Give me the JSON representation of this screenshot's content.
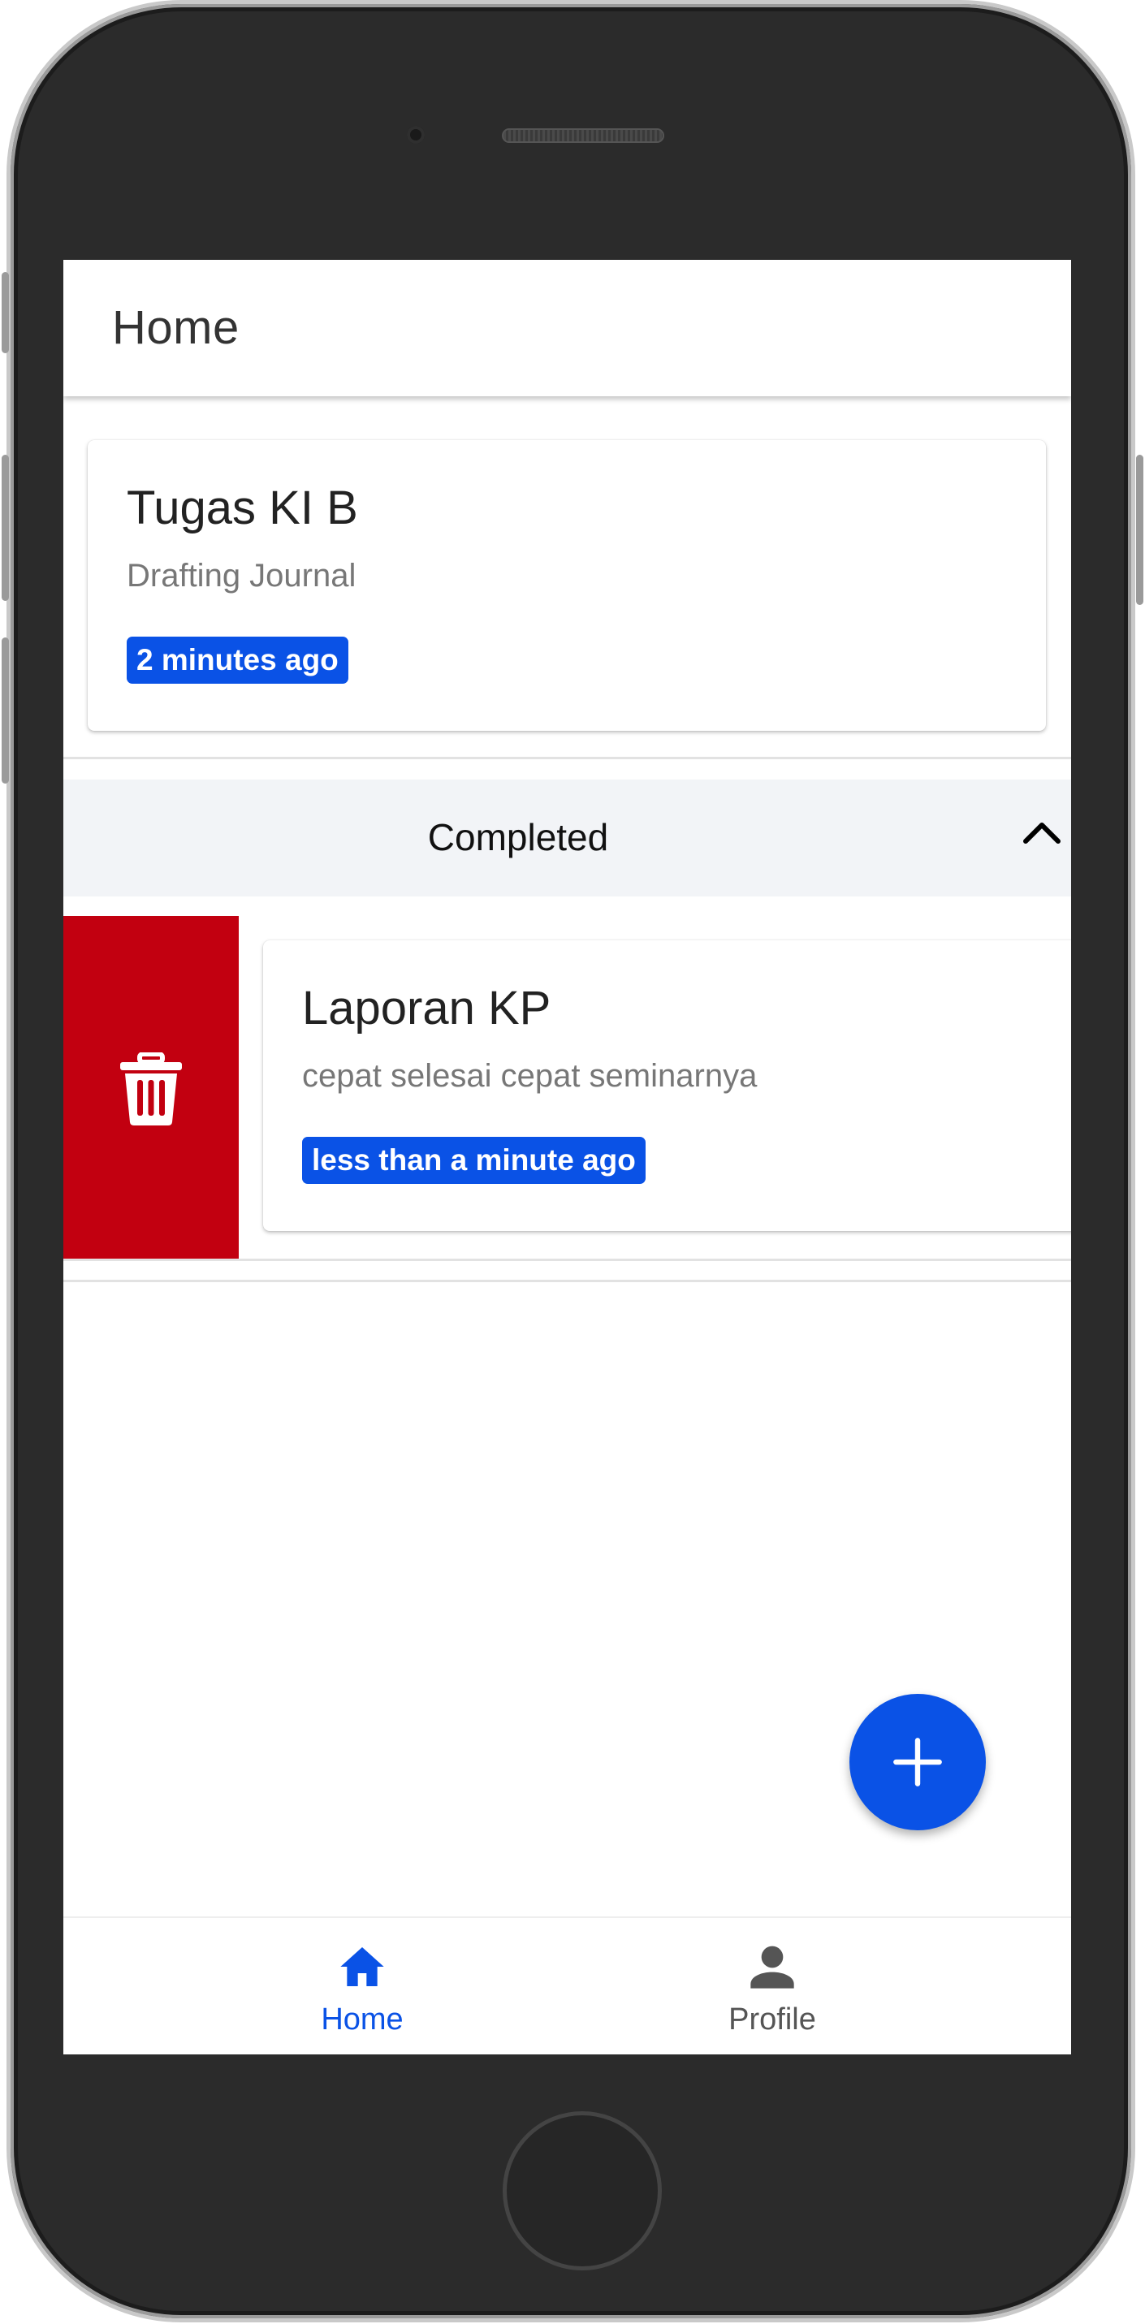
{
  "app": {
    "title": "Home"
  },
  "active_task": {
    "title": "Tugas KI B",
    "description": "Drafting Journal",
    "time": "2 minutes ago"
  },
  "completed_section": {
    "header": "Completed",
    "expanded": true,
    "items": [
      {
        "title": "Laporan KP",
        "description": "cepat selesai cepat seminarnya",
        "time": "less than a minute ago",
        "swipe_action": "delete"
      }
    ]
  },
  "fab": {
    "icon": "plus-icon"
  },
  "bottom_nav": {
    "items": [
      {
        "label": "Home",
        "icon": "home-icon",
        "active": true
      },
      {
        "label": "Profile",
        "icon": "person-icon",
        "active": false
      }
    ]
  },
  "colors": {
    "accent": "#0a52e6",
    "danger": "#c20010",
    "nav_inactive": "#555555"
  }
}
